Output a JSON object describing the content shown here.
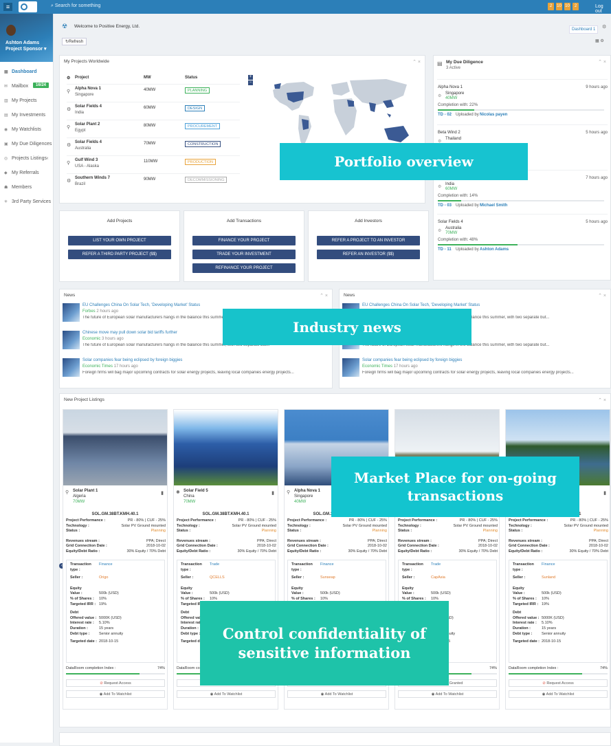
{
  "topbar": {
    "search_placeholder": "Search for something",
    "badges": [
      "2",
      "10",
      "10",
      "2"
    ],
    "logout": "Log out"
  },
  "user": {
    "name": "Ashton Adams",
    "role": "Project Sponsor"
  },
  "sidebar": {
    "items": [
      {
        "label": "Dashboard",
        "icon": "grid-icon"
      },
      {
        "label": "Mailbox",
        "icon": "mail-icon",
        "count": "16/24"
      },
      {
        "label": "My Projects",
        "icon": "bar-chart-icon"
      },
      {
        "label": "My Investments",
        "icon": "doc-icon"
      },
      {
        "label": "My Watchlists",
        "icon": "eye-icon"
      },
      {
        "label": "My Due Diligences",
        "icon": "briefcase-icon"
      },
      {
        "label": "Projects Listings",
        "icon": "list-icon"
      },
      {
        "label": "My Referrals",
        "icon": "share-icon"
      },
      {
        "label": "Members",
        "icon": "users-icon"
      },
      {
        "label": "3rd Party Services",
        "icon": "gear-icon"
      }
    ]
  },
  "header": {
    "welcome": "Welcome to Positive Energy, Ltd.",
    "dashboard_tab": "Dashboard 1",
    "refresh": "Refresh"
  },
  "projects": {
    "title": "My Projects Worldwide",
    "columns": [
      "Project",
      "MW",
      "Status"
    ],
    "rows": [
      {
        "name": "Alpha Nova 1",
        "loc": "Singapore",
        "mw": "40MW",
        "status": "PLANNING",
        "color": "#3cb15a"
      },
      {
        "name": "Solar Fields 4",
        "loc": "India",
        "mw": "60MW",
        "status": "DESIGN",
        "color": "#2c7fb8"
      },
      {
        "name": "Solar Plant 2",
        "loc": "Egypt",
        "mw": "80MW",
        "status": "PROCUREMENT",
        "color": "#4da0d8"
      },
      {
        "name": "Solar Fields 4",
        "loc": "Australia",
        "mw": "70MW",
        "status": "CONSTRUCTION",
        "color": "#334d7e"
      },
      {
        "name": "Gulf Wind 3",
        "loc": "USA - Alaska",
        "mw": "110MW",
        "status": "PRODUCTION",
        "color": "#e8a33a"
      },
      {
        "name": "Southern Winds 7",
        "loc": "Brazil",
        "mw": "90MW",
        "status": "DECOMMISSIONING",
        "color": "#aaaaaa"
      }
    ]
  },
  "due": {
    "title": "My Due Diligence",
    "subtitle": "3 Active",
    "items": [
      {
        "name": "Alpha Nova 1",
        "time": "9 hours ago",
        "loc": "Singapore",
        "mw": "40MW",
        "completion": "Completion with: 22%",
        "pct": 22,
        "td": "TD - 02",
        "by": "Nicolas payen"
      },
      {
        "name": "Beta Wind 2",
        "time": "5 hours ago",
        "loc": "Thailand"
      },
      {
        "name": "",
        "time": "7 hours ago",
        "loc": "India",
        "mw": "60MW",
        "completion": "Completion with: 14%",
        "pct": 14,
        "td": "TD - 03",
        "by": "Michael Smith"
      },
      {
        "name": "Solar Fields 4",
        "time": "5 hours ago",
        "loc": "Australia",
        "mw": "70MW",
        "completion": "Completion with: 48%",
        "pct": 48,
        "td": "TD - 11",
        "by": "Ashton Adams"
      }
    ],
    "uploaded": "Uploaded by"
  },
  "actions": {
    "projects": {
      "title": "Add Projects",
      "buttons": [
        "LIST YOUR OWN PROJECT",
        "REFER A THIRD PARTY PROJECT ($$)"
      ]
    },
    "transactions": {
      "title": "Add Transactions",
      "buttons": [
        "FINANCE YOUR PROJECT",
        "TRADE YOUR INVESTMENT",
        "REFINANCE YOUR PROJECT"
      ]
    },
    "investors": {
      "title": "Add Investors",
      "buttons": [
        "REFER A PROJECT TO AN INVESTOR",
        "REFER AN INVESTOR ($$)"
      ]
    }
  },
  "news": {
    "title": "News",
    "items": [
      {
        "title": "EU Challenges China On Solar Tech, 'Developing Market' Status",
        "source": "Forbes",
        "time": "2 hours ago",
        "snippet": "The future of European solar manufacturers hangs in the balance this summer, with two separate but..."
      },
      {
        "title": "Chinese move may pull down solar bid tariffs further",
        "source": "Economic",
        "time": "3 hours ago",
        "snippet": "The future of European solar manufacturers hangs in the balance this summer, with two separate but..."
      },
      {
        "title": "Solar companies fear being eclipsed by foreign biggies",
        "source": "Economic Times",
        "time": "17 hours ago",
        "snippet": "Foreign firms will bag major upcoming contracts for solar energy projects, leaving local companies energy projects..."
      }
    ]
  },
  "listings": {
    "title": "New Project Listings",
    "code": "SOL.GM.38BT.KMH.40.1",
    "labels": {
      "perf": "Project Performance :",
      "tech": "Technology :",
      "status": "Status :",
      "rev": "Revenues stream :",
      "grid": "Grid Connection Date :",
      "eq": "Equity/Debt Ratio :",
      "ttype": "Transaction type :",
      "seller": "Seller :",
      "equity": "Equity",
      "value": "Value :",
      "shares": "% of Shares :",
      "irr": "Targeted IRR :",
      "debt": "Debt",
      "offered": "Offered value :",
      "rate": "Interest rate :",
      "dur": "Duration :",
      "dtype": "Debt type :",
      "tdate": "Targeted date :",
      "dri": "DataRoom completion Index :"
    },
    "values": {
      "perf": "PR - 80% | CUF - 25%",
      "tech": "Solar PV Ground mounted",
      "status": "Planning",
      "rev": "PPA; Direct",
      "grid": "2018-10-02",
      "eq": "30% Equity / 70% Debt",
      "value": "500k (USD)",
      "shares": "10%",
      "irr": "19%",
      "offered": "5000K (USD)",
      "rate": "5.10%",
      "dur": "15 years",
      "dtype": "Senior annuity",
      "tdate": "2018-10-15",
      "dri_pct": "74%"
    },
    "request": "Request Access",
    "granted": "Access Granted",
    "watch": "Add To Watchlist",
    "cards": [
      {
        "name": "Solar Plant 1",
        "loc": "Algeria",
        "mw": "70MW",
        "ttype": "Finance",
        "seller": "Origo"
      },
      {
        "name": "Solar Field 5",
        "loc": "China",
        "mw": "70MW",
        "ttype": "Trade",
        "seller": "QCELLS"
      },
      {
        "name": "Alpha Nova 1",
        "loc": "Singapore",
        "mw": "40MW",
        "ttype": "Finance",
        "seller": "Sunseap"
      },
      {
        "name": "",
        "loc": "",
        "mw": "",
        "ttype": "Trade",
        "seller": "CapAsia"
      },
      {
        "name": "",
        "loc": "",
        "mw": "",
        "ttype": "Finance",
        "seller": "Sunland"
      }
    ]
  },
  "callouts": {
    "portfolio": "Portfolio overview",
    "news": "Industry news",
    "market": "Market Place for on-going transactions",
    "control": "Control confidentiality of sensitive information"
  },
  "colors": {
    "primary": "#2c7fb8",
    "navy": "#334d7e",
    "green": "#3cb15a",
    "callout_teal": "#13c4cf"
  }
}
